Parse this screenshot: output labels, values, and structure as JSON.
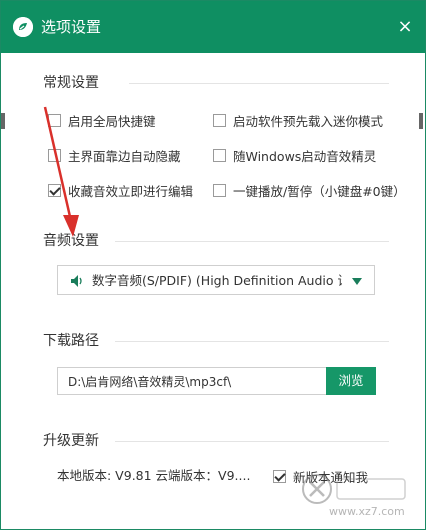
{
  "window": {
    "title": "选项设置",
    "close_glyph": "×"
  },
  "sections": {
    "general": "常规设置",
    "audio": "音频设置",
    "download": "下载路径",
    "update": "升级更新"
  },
  "options": [
    {
      "label": "启用全局快捷键",
      "checked": false
    },
    {
      "label": "启动软件预先载入迷你模式",
      "checked": false
    },
    {
      "label": "主界面靠边自动隐藏",
      "checked": false
    },
    {
      "label": "随Windows启动音效精灵",
      "checked": false
    },
    {
      "label": "收藏音效立即进行编辑",
      "checked": true
    },
    {
      "label": "一键播放/暂停（小键盘#0键）",
      "checked": false
    }
  ],
  "audio": {
    "device": "数字音频(S/PDIF) (High Definition Audio 设",
    "icon": "speaker-icon"
  },
  "download": {
    "path": "D:\\启肯网络\\音效精灵\\mp3cf\\",
    "browse_label": "浏览"
  },
  "update": {
    "version_text": "本地版本: V9.81  云端版本：V9....",
    "notify_label": "新版本通知我",
    "notify_checked": true
  },
  "colors": {
    "accent": "#0f8f62",
    "button": "#169768",
    "annotation_arrow": "#d9302b"
  },
  "watermark": {
    "text": "www.xz7.com",
    "icon": "watermark-logo-icon"
  }
}
